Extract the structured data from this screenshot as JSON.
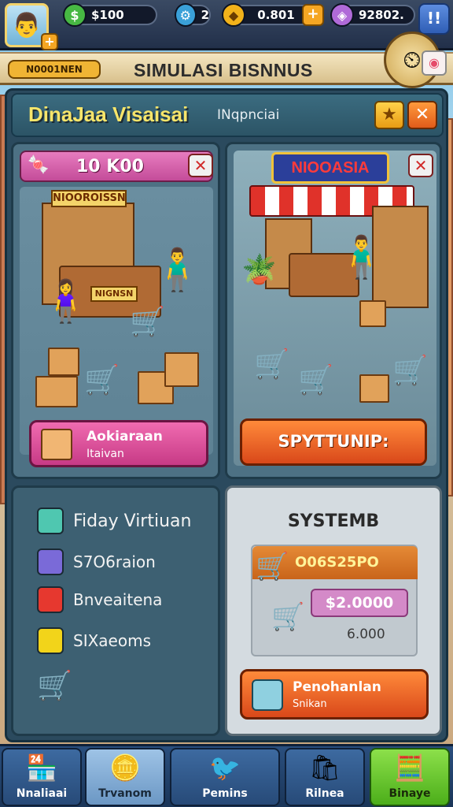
{
  "hud": {
    "money": "$100",
    "energy": "2",
    "gold": "0.801",
    "gems": "92802.",
    "pause_label": "!!"
  },
  "title": {
    "tag": "N0001NEN",
    "text": "SIMULASI BISNNUS"
  },
  "header": {
    "title": "DinaJaa Visaisai",
    "subtitle": "INqpnciai"
  },
  "panel_left_top": {
    "head_label": "10 K00",
    "sign": "NIOOROISSN",
    "banner": "NIGNSN",
    "action": {
      "line1": "Aokiaraan",
      "line2": "Itaivan"
    }
  },
  "panel_right_top": {
    "shop_sign": "NIOOASIA",
    "action_label": "SPYTTUNIP:"
  },
  "panel_left_bot": {
    "items": [
      {
        "label": "Fiday Virtiuan",
        "icon": "stack-icon",
        "color": "#4fc7b0"
      },
      {
        "label": "S7O6raion",
        "icon": "box-icon",
        "color": "#7a6ad8"
      },
      {
        "label": "Bnveaitena",
        "icon": "gift-icon",
        "color": "#e6382f"
      },
      {
        "label": "SIXaeoms",
        "icon": "cube-icon",
        "color": "#f2d41a"
      }
    ]
  },
  "panel_right_bot": {
    "title": "SYSTEMB",
    "value1": "O06S25PO",
    "value2": "$2.0000",
    "value3": "6.000",
    "action": {
      "line1": "Penohanlan",
      "line2": "Snikan"
    }
  },
  "nav": [
    {
      "label": "Nnaliaai",
      "icon": "shop-icon"
    },
    {
      "label": "Trvanom",
      "icon": "coin-icon"
    },
    {
      "label": "Pemins",
      "icon": "bird-icon"
    },
    {
      "label": "Rilnea",
      "icon": "bag-icon"
    },
    {
      "label": "Binaye",
      "icon": "calculator-icon"
    }
  ]
}
